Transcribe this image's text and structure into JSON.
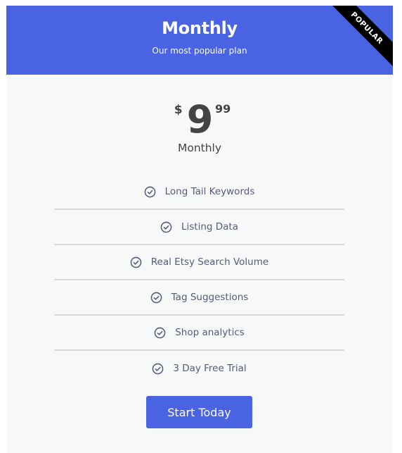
{
  "plan": {
    "title": "Monthly",
    "subtitle": "Our most popular plan",
    "badge": "POPULAR",
    "price": {
      "currency": "$",
      "amount": "9",
      "cents": "99",
      "period": "Monthly"
    },
    "features": [
      {
        "icon": "check-circle-icon",
        "label": "Long Tail Keywords"
      },
      {
        "icon": "check-circle-icon",
        "label": "Listing Data"
      },
      {
        "icon": "check-circle-icon",
        "label": "Real Etsy Search Volume"
      },
      {
        "icon": "check-circle-icon",
        "label": "Tag Suggestions"
      },
      {
        "icon": "check-circle-icon",
        "label": "Shop analytics"
      },
      {
        "icon": "check-circle-icon",
        "label": "3 Day Free Trial"
      }
    ],
    "cta_label": "Start Today"
  },
  "colors": {
    "accent": "#4a63e3",
    "ribbon": "#000000",
    "body_bg": "#f7f8f8",
    "feature_text": "#545c7a",
    "price_text": "#444444"
  }
}
